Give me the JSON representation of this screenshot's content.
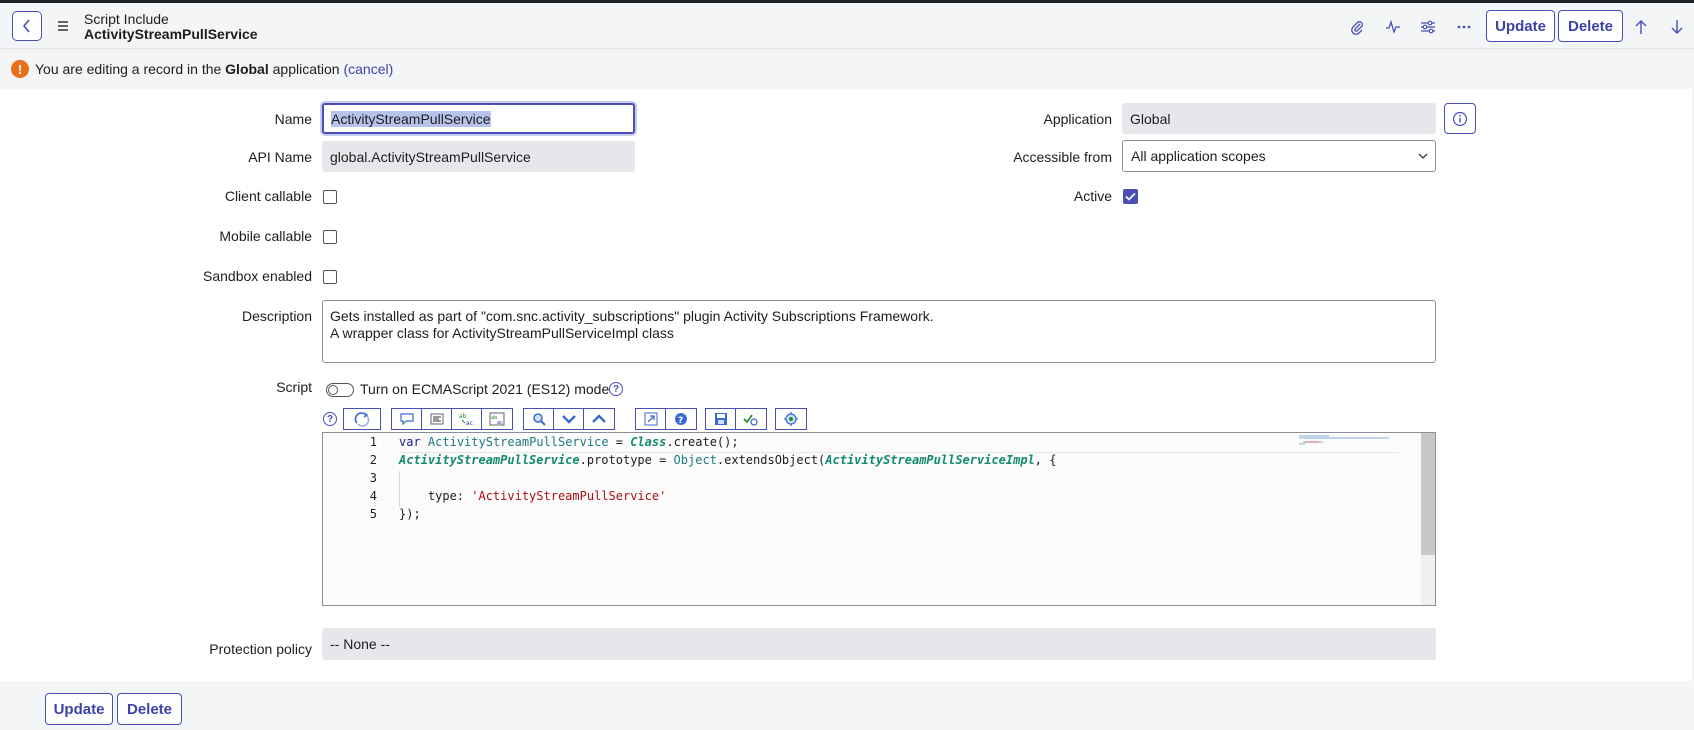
{
  "header": {
    "title_line1": "Script Include",
    "title_line2": "ActivityStreamPullService",
    "update_label": "Update",
    "delete_label": "Delete"
  },
  "notice": {
    "prefix": "You are editing a record in the ",
    "scope": "Global",
    "suffix": " application ",
    "cancel": "(cancel)"
  },
  "form": {
    "name": {
      "label": "Name",
      "value": "ActivityStreamPullService"
    },
    "api_name": {
      "label": "API Name",
      "value": "global.ActivityStreamPullService"
    },
    "client_callable": {
      "label": "Client callable",
      "checked": false
    },
    "mobile_callable": {
      "label": "Mobile callable",
      "checked": false
    },
    "sandbox_enabled": {
      "label": "Sandbox enabled",
      "checked": false
    },
    "application": {
      "label": "Application",
      "value": "Global"
    },
    "accessible_from": {
      "label": "Accessible from",
      "value": "All application scopes"
    },
    "active": {
      "label": "Active",
      "checked": true
    },
    "description": {
      "label": "Description",
      "line1": "Gets installed as part of \"com.snc.activity_subscriptions\" plugin Activity Subscriptions Framework.",
      "line2": "A wrapper class for ActivityStreamPullServiceImpl class"
    },
    "script": {
      "label": "Script",
      "es_mode_label": "Turn on ECMAScript 2021 (ES12) mode",
      "es_mode_on": false,
      "line_numbers": [
        "1",
        "2",
        "3",
        "4",
        "5"
      ]
    },
    "protection_policy": {
      "label": "Protection policy",
      "value": "-- None --"
    }
  },
  "footer": {
    "update_label": "Update",
    "delete_label": "Delete"
  },
  "colors": {
    "accent": "#4a4fb8",
    "warning": "#e8701d",
    "readonly_bg": "#e6e7eb"
  }
}
